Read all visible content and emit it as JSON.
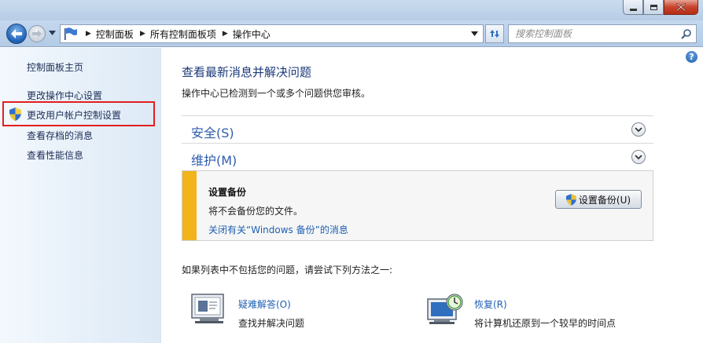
{
  "nav": {
    "breadcrumbs": [
      "控制面板",
      "所有控制面板项",
      "操作中心"
    ],
    "search_placeholder": "搜索控制面板"
  },
  "sidebar": {
    "home": "控制面板主页",
    "items": [
      {
        "label": "更改操作中心设置"
      },
      {
        "label": "更改用户帐户控制设置",
        "highlighted": true
      },
      {
        "label": "查看存档的消息"
      },
      {
        "label": "查看性能信息"
      }
    ]
  },
  "main": {
    "title": "查看最新消息并解决问题",
    "subtitle": "操作中心已检测到一个或多个问题供您审核。",
    "sections": [
      {
        "label": "安全(S)"
      },
      {
        "label": "维护(M)"
      }
    ],
    "alert": {
      "title": "设置备份",
      "message": "将不会备份您的文件。",
      "link": "关闭有关“Windows 备份”的消息",
      "button": "设置备份(U)",
      "accent_color": "#f2b31b"
    },
    "hint": "如果列表中不包括您的问题，请尝试下列方法之一:",
    "tools": [
      {
        "name": "疑难解答(O)",
        "desc": "查找并解决问题",
        "icon": "troubleshoot-icon"
      },
      {
        "name": "恢复(R)",
        "desc": "将计算机还原到一个较早的时间点",
        "icon": "recovery-icon"
      }
    ]
  },
  "colors": {
    "link": "#1e5fb3",
    "heading": "#1c3a7a",
    "highlight_border": "#e21f1f"
  }
}
